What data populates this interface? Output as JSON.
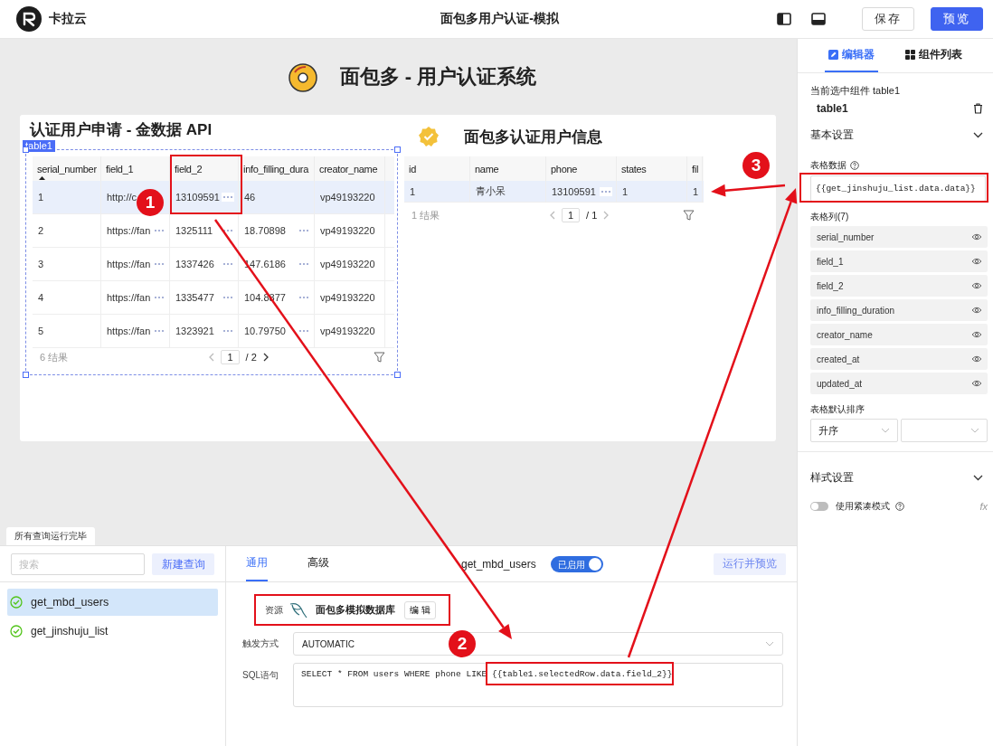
{
  "app": {
    "name": "卡拉云",
    "title": "面包多用户认证-模拟",
    "buttons": [
      {
        "label": "保存",
        "kind": "default"
      },
      {
        "label": "预览",
        "kind": "primary"
      }
    ]
  },
  "canvas": {
    "heading": "面包多 - 用户认证系统",
    "left_table": {
      "title": "认证用户申请 - 金数据 API",
      "tag": "table1",
      "columns": [
        {
          "label": "serial_number",
          "sorted": true
        },
        {
          "label": "field_1",
          "sorted": false
        },
        {
          "label": "field_2",
          "sorted": false
        },
        {
          "label": "info_filling_dura",
          "sorted": false
        },
        {
          "label": "creator_name",
          "sorted": false
        }
      ],
      "rows": [
        {
          "selected": true,
          "cells": [
            {
              "text": "1",
              "more": false
            },
            {
              "text": "http://c",
              "more": false
            },
            {
              "text": "13109591",
              "more": true
            },
            {
              "text": "46",
              "more": false
            },
            {
              "text": "vp49193220",
              "more": false
            }
          ]
        },
        {
          "selected": false,
          "cells": [
            {
              "text": "2",
              "more": false
            },
            {
              "text": "https://fan",
              "more": true
            },
            {
              "text": "1325111",
              "more": true
            },
            {
              "text": "18.70898",
              "more": true
            },
            {
              "text": "vp49193220",
              "more": false
            }
          ]
        },
        {
          "selected": false,
          "cells": [
            {
              "text": "3",
              "more": false
            },
            {
              "text": "https://fan",
              "more": true
            },
            {
              "text": "1337426",
              "more": true
            },
            {
              "text": "147.6186",
              "more": true
            },
            {
              "text": "vp49193220",
              "more": false
            }
          ]
        },
        {
          "selected": false,
          "cells": [
            {
              "text": "4",
              "more": false
            },
            {
              "text": "https://fan",
              "more": true
            },
            {
              "text": "1335477",
              "more": true
            },
            {
              "text": "104.8877",
              "more": true
            },
            {
              "text": "vp49193220",
              "more": false
            }
          ]
        },
        {
          "selected": false,
          "cells": [
            {
              "text": "5",
              "more": false
            },
            {
              "text": "https://fan",
              "more": true
            },
            {
              "text": "1323921",
              "more": true
            },
            {
              "text": "10.79750",
              "more": true
            },
            {
              "text": "vp49193220",
              "more": false
            }
          ]
        }
      ],
      "footer": {
        "count": "6 结果",
        "page": "1",
        "total": "/ 2"
      }
    },
    "right_table": {
      "title": "面包多认证用户信息",
      "columns": [
        {
          "label": "id",
          "sorted": false
        },
        {
          "label": "name",
          "sorted": false
        },
        {
          "label": "phone",
          "sorted": false
        },
        {
          "label": "states",
          "sorted": false
        },
        {
          "label": "fil",
          "sorted": false
        }
      ],
      "rows": [
        {
          "selected": true,
          "cells": [
            {
              "text": "1",
              "more": false
            },
            {
              "text": "青小呆",
              "more": false
            },
            {
              "text": "13109591",
              "more": true
            },
            {
              "text": "1",
              "more": false
            },
            {
              "text": "1",
              "more": false
            }
          ]
        }
      ],
      "footer": {
        "count": "1 结果",
        "page": "1",
        "total": "/ 1"
      }
    },
    "status_tab": "所有查询运行完毕"
  },
  "sidebar": {
    "tabs": [
      {
        "label": "编辑器",
        "selected": true
      },
      {
        "label": "组件列表",
        "selected": false
      }
    ],
    "selected_caption": "当前选中组件 table1",
    "component": "table1",
    "basic_section": "基本设置",
    "data_label": "表格数据",
    "data_value": "{{get_jinshuju_list.data.data}}",
    "columns_label": "表格列(7)",
    "columns": [
      "serial_number",
      "field_1",
      "field_2",
      "info_filling_duration",
      "creator_name",
      "created_at",
      "updated_at"
    ],
    "sort_label": "表格默认排序",
    "sort_value": "升序",
    "style_section": "样式设置",
    "compact": {
      "label": "使用紧凑模式",
      "on": false
    },
    "fx": "fx"
  },
  "query_panel": {
    "search": {
      "placeholder": "搜索"
    },
    "new_button": "新建查询",
    "queries": [
      {
        "name": "get_mbd_users",
        "selected": true
      },
      {
        "name": "get_jinshuju_list",
        "selected": false
      }
    ],
    "tabs": [
      {
        "label": "通用",
        "selected": true
      },
      {
        "label": "高级",
        "selected": false
      }
    ],
    "query_name": "get_mbd_users",
    "enabled": {
      "label": "已启用",
      "on": true
    },
    "run_button": "运行并预览",
    "resource": {
      "label": "资源",
      "value": "面包多模拟数据库",
      "edit": "编 辑"
    },
    "trigger": {
      "label": "触发方式",
      "value": "AUTOMATIC"
    },
    "sql": {
      "label": "SQL语句",
      "value": "SELECT * FROM users WHERE phone LIKE {{table1.selectedRow.data.field_2}}"
    }
  },
  "annotations": [
    {
      "number": "1"
    },
    {
      "number": "2"
    },
    {
      "number": "3"
    }
  ]
}
